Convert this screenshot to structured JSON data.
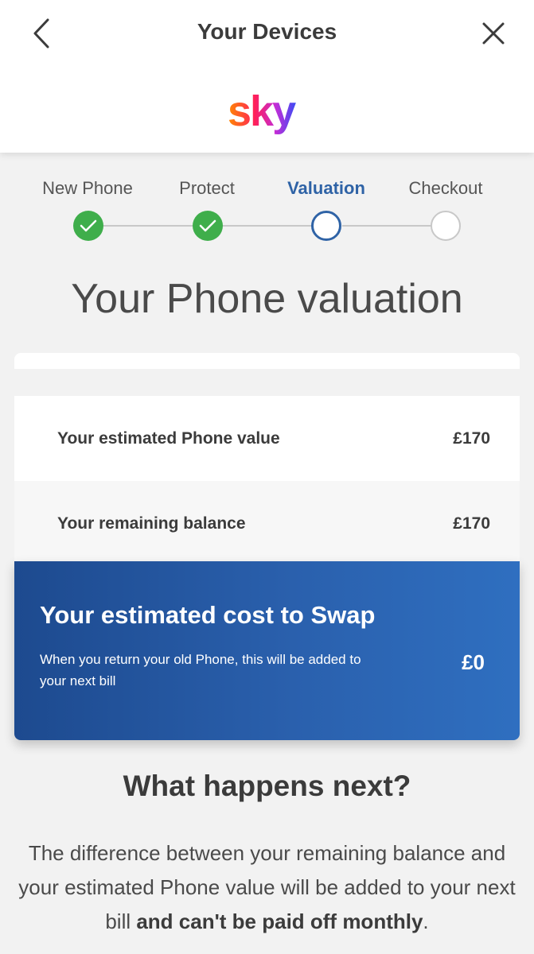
{
  "header": {
    "title": "Your Devices",
    "logo_text": "sky",
    "back_icon": "chevron-left-icon",
    "close_icon": "close-icon"
  },
  "stepper": {
    "steps": [
      {
        "label": "New Phone",
        "state": "done"
      },
      {
        "label": "Protect",
        "state": "done"
      },
      {
        "label": "Valuation",
        "state": "current"
      },
      {
        "label": "Checkout",
        "state": "future"
      }
    ],
    "colors": {
      "done": "#3fae4b",
      "current": "#2f63a6",
      "future": "#c8c8c8"
    }
  },
  "page": {
    "title": "Your Phone valuation"
  },
  "valuation": {
    "rows": [
      {
        "label": "Your estimated Phone value",
        "value": "£170"
      },
      {
        "label": "Your remaining balance",
        "value": "£170"
      }
    ],
    "swap": {
      "title": "Your estimated cost to Swap",
      "description": "When you return your old Phone, this will be added to your next bill",
      "value": "£0"
    }
  },
  "next": {
    "title": "What happens next?",
    "body_plain": "The difference between your remaining balance and your estimated Phone value will be added to your next bill ",
    "body_bold": "and can't be paid off monthly",
    "body_end": "."
  }
}
